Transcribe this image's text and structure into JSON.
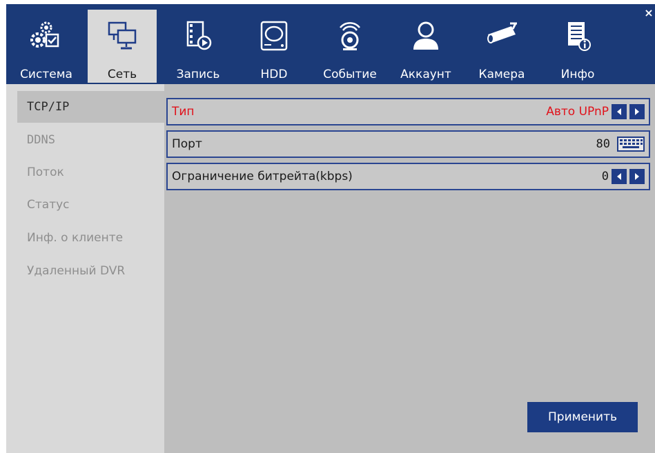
{
  "window": {
    "close_glyph": "×"
  },
  "tabs": [
    {
      "label": "Система",
      "icon": "system-settings-icon"
    },
    {
      "label": "Сеть",
      "icon": "network-icon",
      "active": true
    },
    {
      "label": "Запись",
      "icon": "record-icon"
    },
    {
      "label": "HDD",
      "icon": "hdd-icon"
    },
    {
      "label": "Событие",
      "icon": "alarm-event-icon"
    },
    {
      "label": "Аккаунт",
      "icon": "user-account-icon"
    },
    {
      "label": "Камера",
      "icon": "camera-icon"
    },
    {
      "label": "Инфо",
      "icon": "info-icon"
    }
  ],
  "sidebar": {
    "items": [
      {
        "label": "TCP/IP",
        "active": true
      },
      {
        "label": "DDNS"
      },
      {
        "label": "Поток"
      },
      {
        "label": "Статус"
      },
      {
        "label": "Инф. о клиенте"
      },
      {
        "label": "Удаленный DVR"
      }
    ]
  },
  "settings": {
    "type": {
      "label": "Тип",
      "value": "Авто UPnP"
    },
    "port": {
      "label": "Порт",
      "value": "80"
    },
    "bitrate": {
      "label": "Ограничение битрейта(kbps)",
      "value": "0"
    }
  },
  "apply_label": "Применить",
  "colors": {
    "frame": "#1b3a78",
    "accent_red": "#e0121b",
    "panel": "#bebebe",
    "button": "#1c3c84"
  }
}
